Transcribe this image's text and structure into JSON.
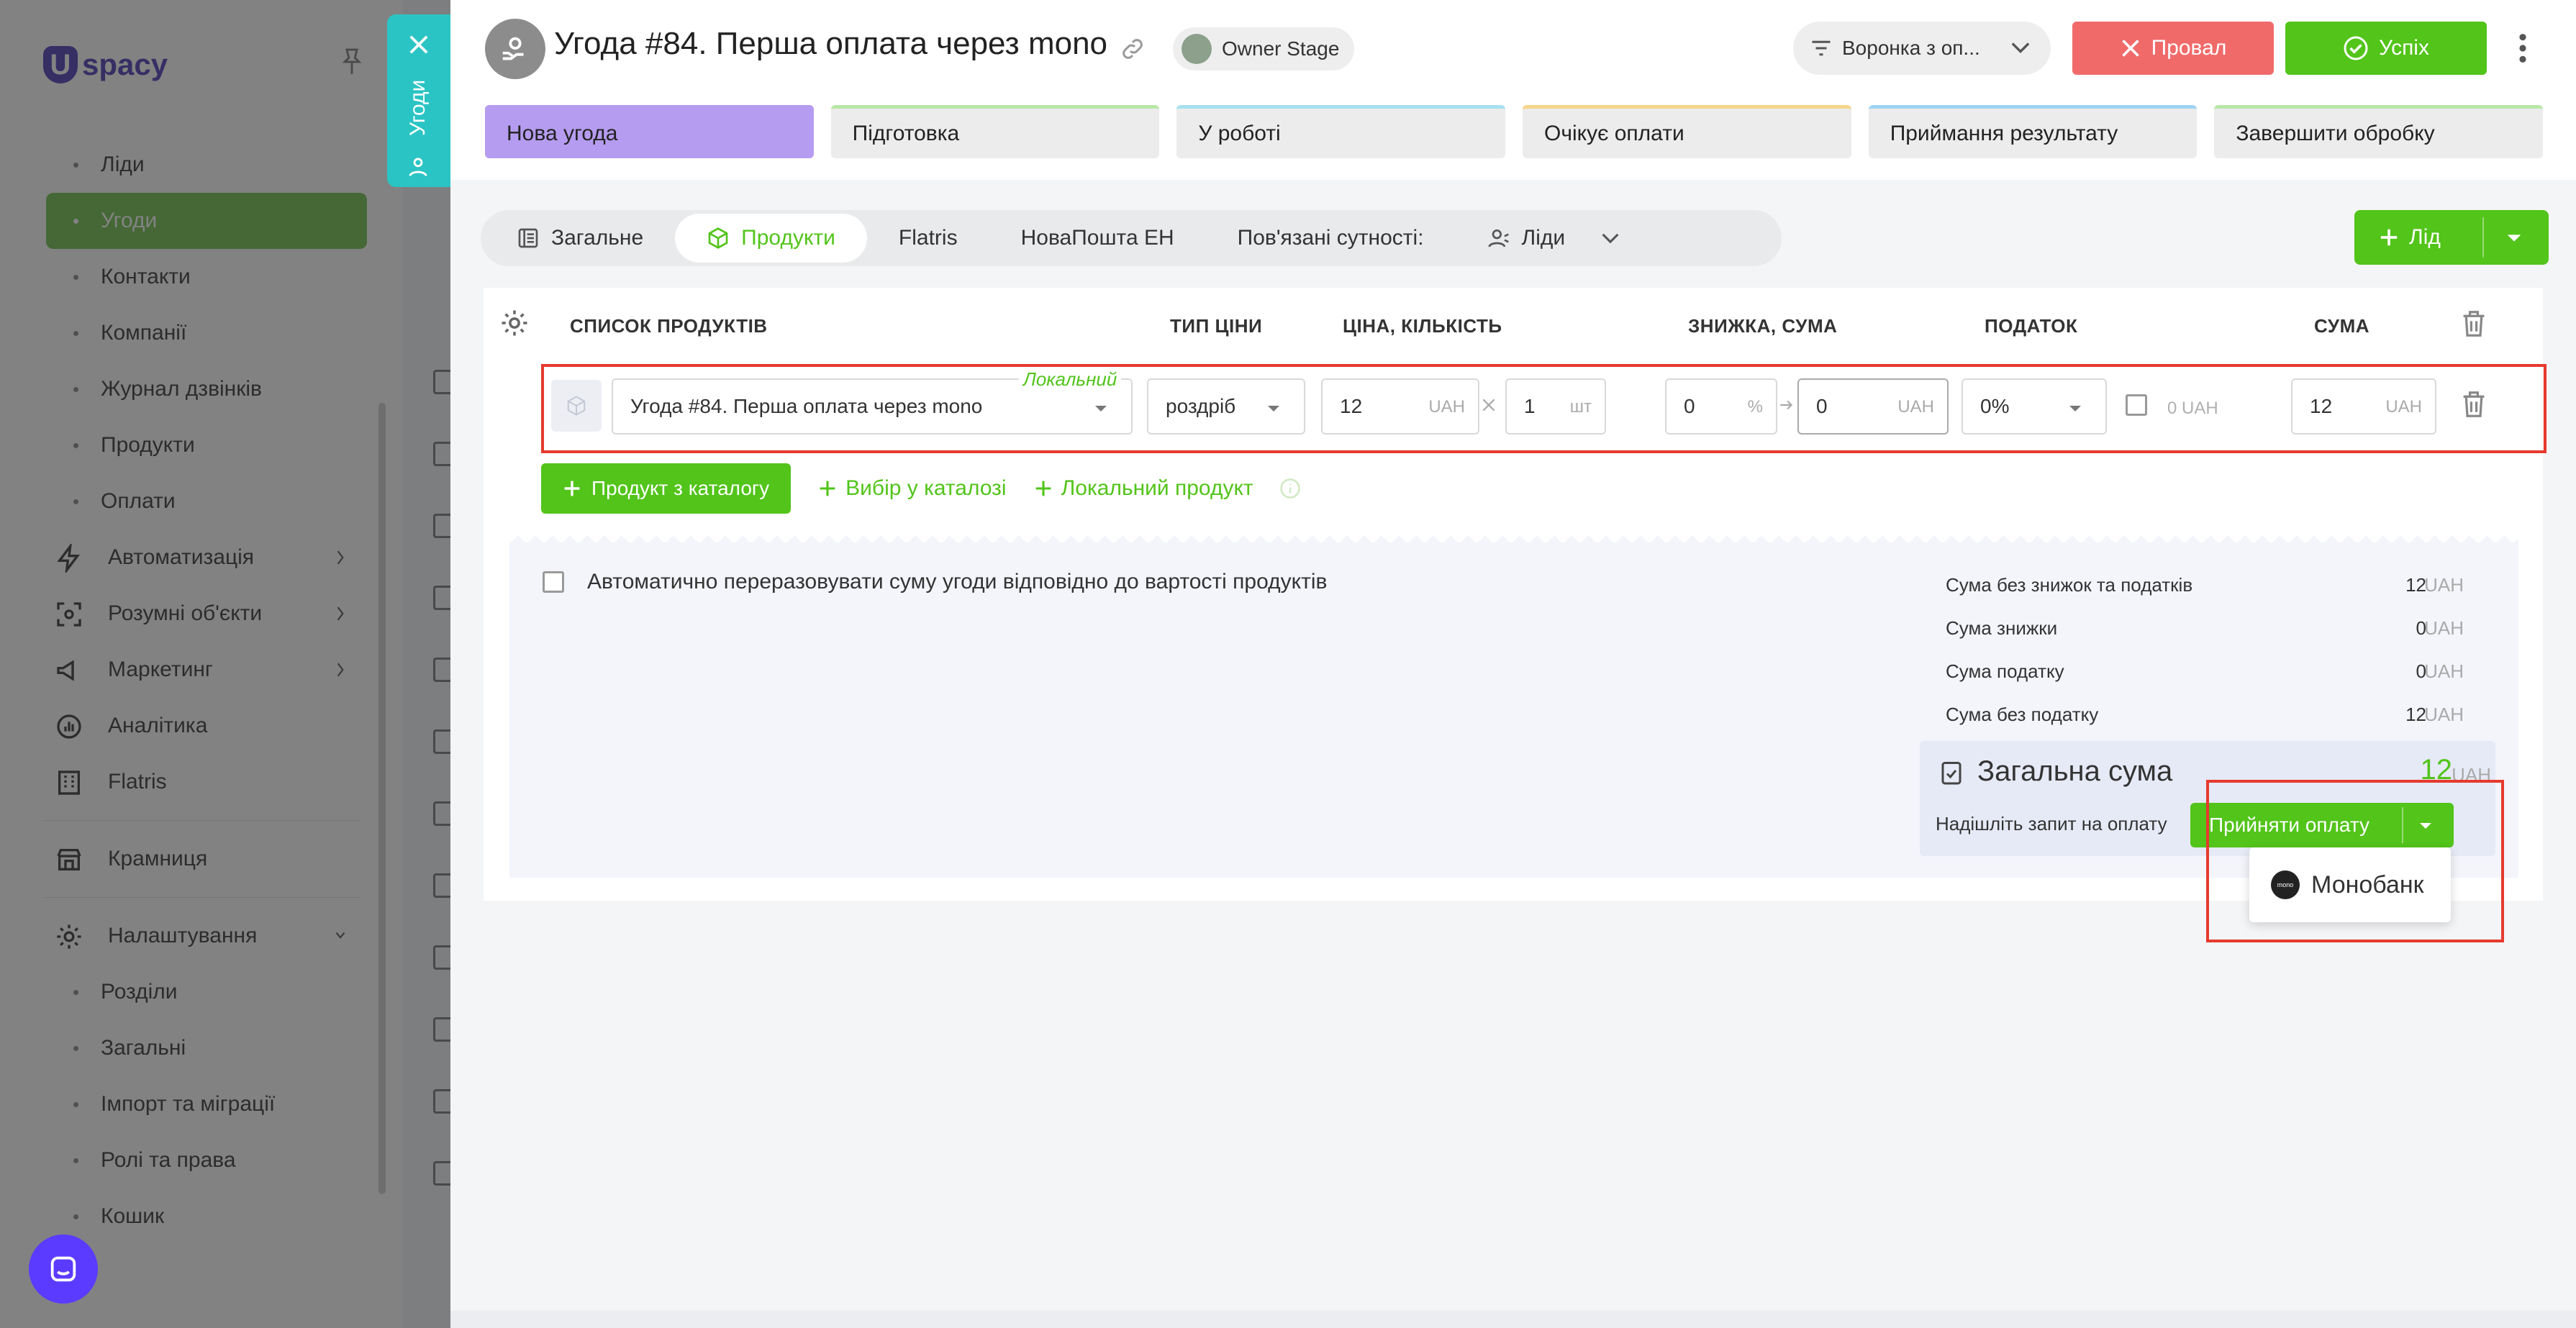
{
  "sidebar": {
    "brand": "spacy",
    "items": [
      {
        "label": "Ліди",
        "type": "sub"
      },
      {
        "label": "Угоди",
        "type": "sub",
        "active": true
      },
      {
        "label": "Контакти",
        "type": "sub"
      },
      {
        "label": "Компанії",
        "type": "sub"
      },
      {
        "label": "Журнал дзвінків",
        "type": "sub"
      },
      {
        "label": "Продукти",
        "type": "sub"
      },
      {
        "label": "Оплати",
        "type": "sub"
      },
      {
        "label": "Автоматизація",
        "type": "top",
        "icon": "lightning-icon",
        "chevron": true
      },
      {
        "label": "Розумні об'єкти",
        "type": "top",
        "icon": "scan-icon",
        "chevron": true
      },
      {
        "label": "Маркетинг",
        "type": "top",
        "icon": "megaphone-icon",
        "chevron": true
      },
      {
        "label": "Аналітика",
        "type": "top",
        "icon": "chart-icon"
      },
      {
        "label": "Flatris",
        "type": "top",
        "icon": "building-icon"
      },
      {
        "label": "Крамниця",
        "type": "top",
        "icon": "store-icon"
      },
      {
        "label": "Налаштування",
        "type": "top",
        "icon": "gear-icon",
        "chevron": true
      },
      {
        "label": "Розділи",
        "type": "sub"
      },
      {
        "label": "Загальні",
        "type": "sub"
      },
      {
        "label": "Імпорт та міграції",
        "type": "sub"
      },
      {
        "label": "Ролі та права",
        "type": "sub"
      },
      {
        "label": "Кошик",
        "type": "sub"
      }
    ]
  },
  "sidetab": {
    "label": "Угоди"
  },
  "header": {
    "title": "Угода #84. Перша оплата через mono",
    "owner": "Owner Stage",
    "funnel": "Воронка з оп...",
    "fail_label": "Провал",
    "success_label": "Успіх"
  },
  "stages": [
    {
      "label": "Нова угода",
      "color": "#b69cf0",
      "active": true
    },
    {
      "label": "Підготовка",
      "color": "#b8e7a8"
    },
    {
      "label": "У роботі",
      "color": "#a6e1f0"
    },
    {
      "label": "Очікує оплати",
      "color": "#f5d58a"
    },
    {
      "label": "Приймання результату",
      "color": "#9dd3f2"
    },
    {
      "label": "Завершити обробку",
      "color": "#b8e7a8"
    }
  ],
  "tabs": [
    {
      "label": "Загальне",
      "icon": "list-icon"
    },
    {
      "label": "Продукти",
      "icon": "cube-icon",
      "active": true
    },
    {
      "label": "Flatris"
    },
    {
      "label": "НоваПошта ЕН"
    },
    {
      "label": "Пов'язані сутності:"
    },
    {
      "label": "Ліди",
      "icon": "user-icon"
    }
  ],
  "lead_button": "Лід",
  "products": {
    "headers": {
      "list": "СПИСОК ПРОДУКТІВ",
      "price_type": "ТИП ЦІНИ",
      "price_qty": "ЦІНА, КІЛЬКІСТЬ",
      "discount": "ЗНИЖКА, СУМА",
      "tax": "ПОДАТОК",
      "sum": "СУМА"
    },
    "row": {
      "name": "Угода #84. Перша оплата через mono",
      "badge": "Локальний",
      "price_type": "роздріб",
      "price": "12",
      "price_unit": "UAH",
      "qty": "1",
      "qty_unit": "шт",
      "discount_pct": "0",
      "discount_pct_unit": "%",
      "discount_amt": "0",
      "discount_amt_unit": "UAH",
      "tax": "0%",
      "tax_amount": "0 UAH",
      "sum": "12",
      "sum_unit": "UAH"
    },
    "actions": {
      "from_catalog": "Продукт з каталогу",
      "choose": "Вибір у каталозі",
      "local": "Локальний продукт"
    }
  },
  "summary": {
    "auto_recalc": "Автоматично переразовувати суму угоди відповідно до вартості продуктів",
    "lines": [
      {
        "label": "Сума без знижок та податків",
        "value": "12",
        "currency": "UAH"
      },
      {
        "label": "Сума знижки",
        "value": "0",
        "currency": "UAH"
      },
      {
        "label": "Сума податку",
        "value": "0",
        "currency": "UAH"
      },
      {
        "label": "Сума без податку",
        "value": "12",
        "currency": "UAH"
      }
    ],
    "total_label": "Загальна сума",
    "total_value": "12",
    "total_currency": "UAH",
    "request_text": "Надішліть запит на оплату",
    "accept_button": "Прийняти оплату",
    "menu_item": "Монобанк",
    "menu_logo_text": "mono"
  },
  "colors": {
    "accent": "#52c41a",
    "fail": "#f06a6a",
    "highlight": "#e63a2e"
  }
}
